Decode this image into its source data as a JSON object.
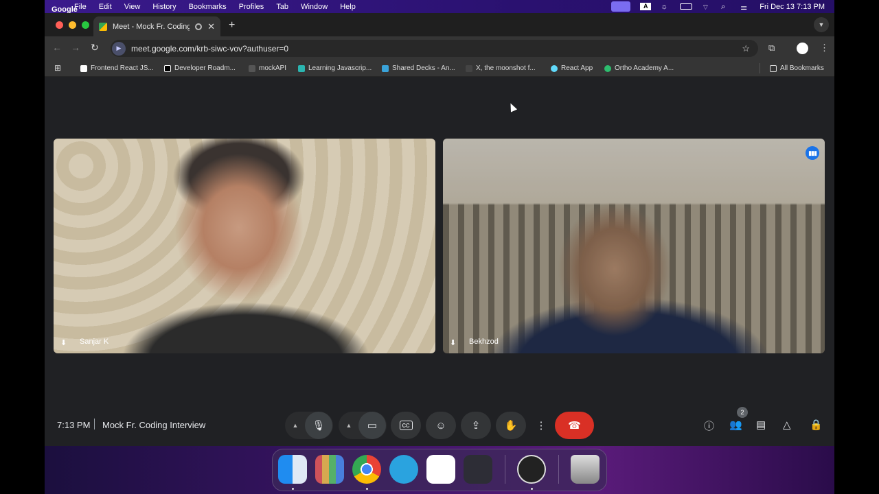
{
  "menubar": {
    "app_name": "Google Chrome",
    "items": [
      "File",
      "Edit",
      "View",
      "History",
      "Bookmarks",
      "Profiles",
      "Tab",
      "Window",
      "Help"
    ],
    "datetime": "Fri Dec 13  7:13 PM",
    "input_source": "A"
  },
  "tab": {
    "title": "Meet - Mock Fr. Coding In",
    "new_tab": "+",
    "close": "✕"
  },
  "omnibox": {
    "url": "meet.google.com/krb-siwc-vov?authuser=0"
  },
  "bookmarks": {
    "items": [
      "Frontend React JS...",
      "Developer Roadm...",
      "mockAPI",
      "Learning Javascrip...",
      "Shared Decks - An...",
      "X, the moonshot f...",
      "React App",
      "Ortho Academy A..."
    ],
    "all_bookmarks": "All Bookmarks"
  },
  "meeting": {
    "time": "7:13 PM",
    "title": "Mock Fr. Coding Interview",
    "participant_count": "2",
    "participants": [
      {
        "name": "Sanjar K"
      },
      {
        "name": "Bekhzod"
      }
    ]
  },
  "colors": {
    "meet_bg": "#202124",
    "end_call": "#d93025",
    "speaking": "#1a73e8"
  }
}
